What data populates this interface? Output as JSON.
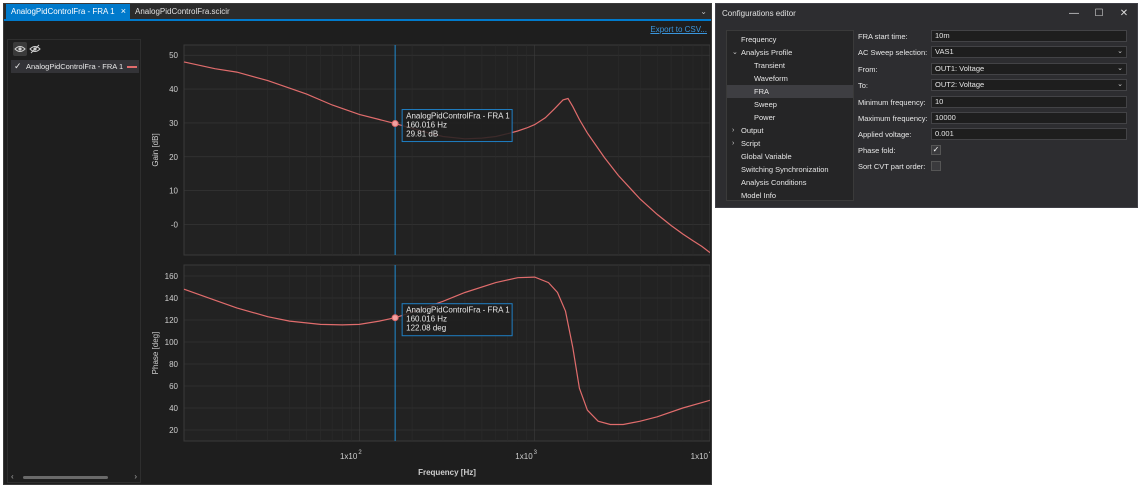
{
  "fra_window": {
    "tabs": [
      {
        "label": "AnalogPidControlFra - FRA 1",
        "active": true
      },
      {
        "label": "AnalogPidControlFra.scicir",
        "active": false
      }
    ],
    "tab_close_glyph": "×",
    "overflow_glyph": "⌄",
    "export_link": "Export to CSV...",
    "legend_item": {
      "label": "AnalogPidControlFra - FRA 1",
      "checked": true,
      "color": "#e06c6c"
    },
    "icons": {
      "show": "eye-icon",
      "hide": "eye-off-icon"
    }
  },
  "colors": {
    "background": "#1e1e1e",
    "plot_background": "#222222",
    "grid": "#3a3a3a",
    "trace": "#e06c6c",
    "cursor": "#1f8ad0",
    "tooltip_border": "#1f7fc4",
    "accent": "#007acc"
  },
  "chart_data": [
    {
      "type": "line",
      "name": "gain",
      "ylabel": "Gain [dB]",
      "xlabel": "",
      "xscale": "log",
      "xlim": [
        10,
        10000
      ],
      "ylim": [
        -9,
        53
      ],
      "yticks": [
        0,
        10,
        20,
        30,
        40,
        50
      ],
      "ytick_labels": [
        "-0",
        "10",
        "20",
        "30",
        "40",
        "50"
      ],
      "grid": true,
      "series": [
        {
          "name": "AnalogPidControlFra - FRA 1",
          "x": [
            10,
            15,
            20,
            30,
            50,
            70,
            100,
            130,
            160,
            200,
            250,
            300,
            400,
            500,
            600,
            700,
            800,
            900,
            1000,
            1150,
            1300,
            1450,
            1550,
            1650,
            1800,
            2000,
            2500,
            3000,
            4000,
            5000,
            6000,
            7000,
            8000,
            9000,
            10000
          ],
          "y": [
            48,
            46,
            45,
            42.5,
            38.5,
            35.3,
            32.5,
            31.0,
            29.8,
            28.4,
            27.0,
            26.0,
            25.3,
            25.5,
            26.0,
            26.8,
            27.6,
            28.5,
            29.5,
            31.5,
            34.2,
            36.8,
            37.2,
            34.8,
            31.0,
            27.0,
            19.8,
            14.5,
            7.5,
            3.0,
            -0.3,
            -2.8,
            -4.8,
            -6.5,
            -8.3
          ]
        }
      ],
      "cursor": {
        "x_text": "160.016 Hz",
        "y_text": "29.81  dB",
        "title": "AnalogPidControlFra - FRA 1",
        "x": 160.016,
        "y": 29.81
      }
    },
    {
      "type": "line",
      "name": "phase",
      "ylabel": "Phase [deg]",
      "xlabel": "Frequency [Hz]",
      "xscale": "log",
      "xlim": [
        10,
        10000
      ],
      "ylim": [
        10,
        170
      ],
      "yticks": [
        20,
        40,
        60,
        80,
        100,
        120,
        140,
        160
      ],
      "ytick_labels": [
        "20",
        "40",
        "60",
        "80",
        "100",
        "120",
        "140",
        "160"
      ],
      "xtick_labels": [
        "1x10",
        "1x10",
        "1x10"
      ],
      "xtick_exponents": [
        "2",
        "3",
        "4"
      ],
      "xtick_values": [
        100,
        1000,
        10000
      ],
      "grid": true,
      "series": [
        {
          "name": "AnalogPidControlFra - FRA 1",
          "x": [
            10,
            15,
            20,
            30,
            40,
            60,
            80,
            100,
            130,
            160,
            200,
            300,
            400,
            600,
            800,
            1000,
            1200,
            1350,
            1500,
            1650,
            1800,
            2000,
            2300,
            2700,
            3200,
            4000,
            5000,
            7000,
            10000
          ],
          "y": [
            148,
            138,
            131,
            123,
            119,
            116,
            115.5,
            116,
            119,
            122.1,
            127,
            137,
            145,
            154,
            158.5,
            159,
            154,
            145,
            128,
            95,
            58,
            38,
            28,
            25,
            25,
            28,
            32,
            40,
            47
          ]
        }
      ],
      "cursor": {
        "x_text": "160.016 Hz",
        "y_text": "122.08  deg",
        "title": "AnalogPidControlFra - FRA 1",
        "x": 160.016,
        "y": 122.08
      }
    }
  ],
  "config_editor": {
    "title": "Configurations editor",
    "window_controls": {
      "minimize": "—",
      "maximize": "☐",
      "close": "✕"
    },
    "tree": [
      {
        "label": "Frequency",
        "level": 0,
        "chevron": ""
      },
      {
        "label": "Analysis Profile",
        "level": 0,
        "chevron": "⌄"
      },
      {
        "label": "Transient",
        "level": 1,
        "chevron": ""
      },
      {
        "label": "Waveform",
        "level": 1,
        "chevron": ""
      },
      {
        "label": "FRA",
        "level": 1,
        "chevron": "",
        "selected": true
      },
      {
        "label": "Sweep",
        "level": 1,
        "chevron": ""
      },
      {
        "label": "Power",
        "level": 1,
        "chevron": ""
      },
      {
        "label": "Output",
        "level": 0,
        "chevron": "›"
      },
      {
        "label": "Script",
        "level": 0,
        "chevron": "›"
      },
      {
        "label": "Global Variable",
        "level": 0,
        "chevron": ""
      },
      {
        "label": "Switching Synchronization",
        "level": 0,
        "chevron": ""
      },
      {
        "label": "Analysis Conditions",
        "level": 0,
        "chevron": ""
      },
      {
        "label": "Model Info",
        "level": 0,
        "chevron": ""
      }
    ],
    "fields": {
      "fra_start_time": {
        "label": "FRA start time:",
        "value": "10m"
      },
      "ac_sweep_selection": {
        "label": "AC Sweep selection:",
        "value": "VAS1"
      },
      "from": {
        "label": "From:",
        "value": "OUT1: Voltage"
      },
      "to": {
        "label": "To:",
        "value": "OUT2: Voltage"
      },
      "min_frequency": {
        "label": "Minimum frequency:",
        "value": "10"
      },
      "max_frequency": {
        "label": "Maximum frequency:",
        "value": "10000"
      },
      "applied_voltage": {
        "label": "Applied voltage:",
        "value": "0.001"
      },
      "phase_fold": {
        "label": "Phase fold:",
        "checked": true,
        "mark": "✓"
      },
      "sort_cvt": {
        "label": "Sort CVT part order:",
        "checked": false,
        "mark": ""
      }
    },
    "select_arrow": "⌄"
  }
}
